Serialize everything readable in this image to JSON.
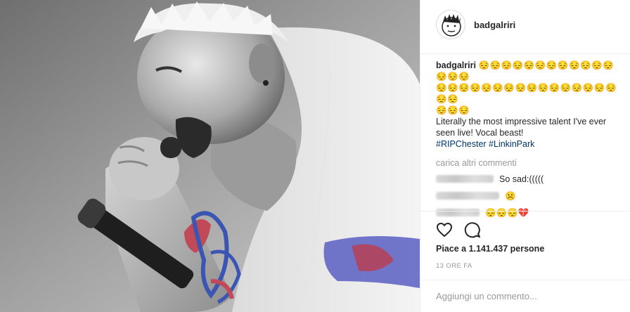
{
  "post": {
    "username": "badgalriri",
    "caption": {
      "username": "badgalriri",
      "emojis_line1": "😔😔😔😔😔😔😔😔😔😔😔😔😔😔😔",
      "emojis_line2": "😔😔😔😔😔😔😔😔😔😔😔😔😔😔😔😔😔😔",
      "emojis_line3": "😔😔😔",
      "text": "Literally the most impressive talent I've ever seen live! Vocal beast!",
      "hashtags": [
        "#RIPChester",
        "#LinkinPark"
      ]
    },
    "load_more_label": "carica altri commenti",
    "comments": [
      {
        "text": "So sad:((((("
      },
      {
        "text": "☹️"
      },
      {
        "text": "😔😔😔💔"
      }
    ],
    "likes_label": "Piace a 1.141.437 persone",
    "time_ago": "13 ORE FA",
    "comment_placeholder": "Aggiungi un commento..."
  },
  "icons": {
    "like": "heart-icon",
    "comment": "comment-bubble-icon"
  }
}
